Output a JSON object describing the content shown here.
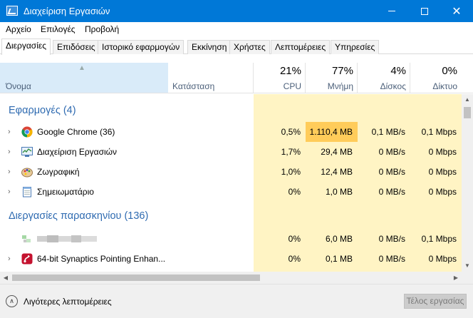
{
  "window": {
    "title": "Διαχείριση Εργασιών",
    "icon": "task-manager-icon"
  },
  "menu": [
    "Αρχείο",
    "Επιλογές",
    "Προβολή"
  ],
  "tabs": [
    "Διεργασίες",
    "Επιδόσεις",
    "Ιστορικό εφαρμογών",
    "Εκκίνηση",
    "Χρήστες",
    "Λεπτομέρειες",
    "Υπηρεσίες"
  ],
  "active_tab": "Διεργασίες",
  "columns": {
    "name": "Όνομα",
    "status": "Κατάσταση",
    "cpu": {
      "pct": "21%",
      "label": "CPU"
    },
    "memory": {
      "pct": "77%",
      "label": "Μνήμη"
    },
    "disk": {
      "pct": "4%",
      "label": "Δίσκος"
    },
    "network": {
      "pct": "0%",
      "label": "Δίκτυο"
    }
  },
  "groups": {
    "apps": "Εφαρμογές (4)",
    "background": "Διεργασίες παρασκηνίου (136)"
  },
  "processes": [
    {
      "name": "Google Chrome (36)",
      "icon": "chrome-icon",
      "cpu": "0,5%",
      "mem": "1.110,4 MB",
      "disk": "0,1 MB/s",
      "net": "0,1 Mbps"
    },
    {
      "name": "Διαχείριση Εργασιών",
      "icon": "task-manager-icon",
      "cpu": "1,7%",
      "mem": "29,4 MB",
      "disk": "0 MB/s",
      "net": "0 Mbps"
    },
    {
      "name": "Ζωγραφική",
      "icon": "paint-icon",
      "cpu": "1,0%",
      "mem": "12,4 MB",
      "disk": "0 MB/s",
      "net": "0 Mbps"
    },
    {
      "name": "Σημειωματάριο",
      "icon": "notepad-icon",
      "cpu": "0%",
      "mem": "1,0 MB",
      "disk": "0 MB/s",
      "net": "0 Mbps"
    },
    {
      "name": "",
      "icon": "blurred-process-icon",
      "cpu": "0%",
      "mem": "6,0 MB",
      "disk": "0 MB/s",
      "net": "0,1 Mbps"
    },
    {
      "name": "64-bit Synaptics Pointing Enhan...",
      "icon": "synaptics-icon",
      "cpu": "0%",
      "mem": "0,1 MB",
      "disk": "0 MB/s",
      "net": "0 Mbps"
    }
  ],
  "footer": {
    "fewer_details": "Λιγότερες λεπτομέρειες",
    "end_task": "Τέλος εργασίας"
  },
  "colors": {
    "titlebar": "#0078d7",
    "group_text": "#2f6bb1",
    "cell_bg": "#fff4c4",
    "mem_bg": "#ffcc5a"
  }
}
